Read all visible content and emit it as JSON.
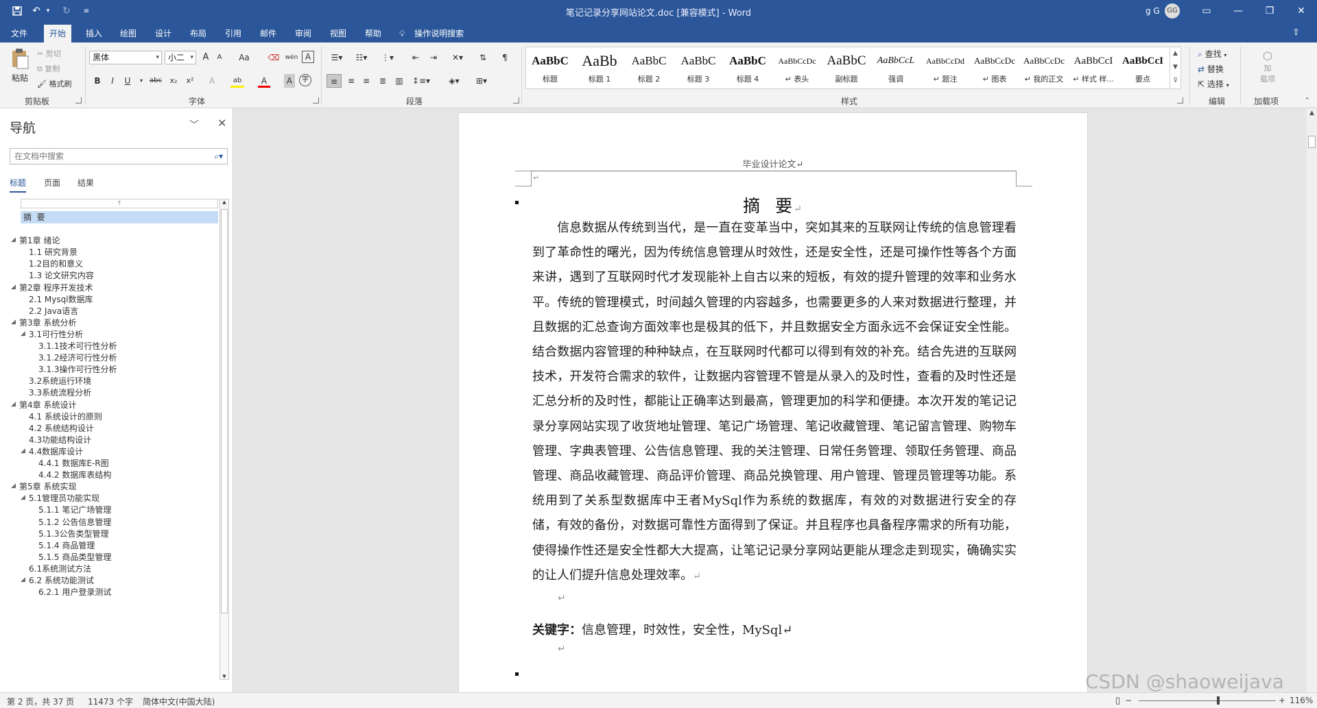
{
  "title_bar": {
    "document_title": "笔记记录分享网站论文.doc [兼容模式]  -  Word",
    "user_name": "g G",
    "user_initials": "GG",
    "quick_access": [
      "save-icon",
      "undo-icon",
      "redo-icon",
      "customize-icon"
    ],
    "window_buttons": [
      "ribbon-display-icon",
      "minimize-icon",
      "restore-icon",
      "close-icon"
    ]
  },
  "menu": {
    "tabs": [
      "文件",
      "开始",
      "插入",
      "绘图",
      "设计",
      "布局",
      "引用",
      "邮件",
      "审阅",
      "视图",
      "帮助"
    ],
    "active_tab": "开始",
    "tell_me": "操作说明搜索"
  },
  "ribbon": {
    "clipboard": {
      "label": "剪贴板",
      "paste": "粘贴",
      "cut": "剪切",
      "copy": "复制",
      "format_painter": "格式刷"
    },
    "font": {
      "label": "字体",
      "font_name": "黑体",
      "font_size": "小二",
      "case": "Aa",
      "grow": "A",
      "shrink": "A",
      "bold": "B",
      "italic": "I",
      "underline": "U",
      "strike": "abc",
      "subscript": "x₂",
      "superscript": "x²",
      "text_effects": "A",
      "highlight": "ab",
      "font_color": "A",
      "char_shading": "A",
      "enclose": "字",
      "pinyin": "wén",
      "char_border": "A"
    },
    "paragraph": {
      "label": "段落"
    },
    "styles": {
      "label": "样式",
      "items": [
        {
          "sample": "AaBbC",
          "name": "标题"
        },
        {
          "sample": "AaBb",
          "name": "标题 1"
        },
        {
          "sample": "AaBbC",
          "name": "标题 2"
        },
        {
          "sample": "AaBbC",
          "name": "标题 3"
        },
        {
          "sample": "AaBbC",
          "name": "标题 4"
        },
        {
          "sample": "AaBbCcDc",
          "name": "↵ 表头"
        },
        {
          "sample": "AaBbC",
          "name": "副标题"
        },
        {
          "sample": "AaBbCcL",
          "name": "强调"
        },
        {
          "sample": "AaBbCcDd",
          "name": "↵ 题注"
        },
        {
          "sample": "AaBbCcDc",
          "name": "↵ 图表"
        },
        {
          "sample": "AaBbCcDc",
          "name": "↵ 我的正文"
        },
        {
          "sample": "AaBbCcI",
          "name": "↵ 样式 样..."
        },
        {
          "sample": "AaBbCcI",
          "name": "要点"
        }
      ]
    },
    "editing": {
      "label": "编辑",
      "find": "查找",
      "replace": "替换",
      "select": "选择"
    },
    "addins": {
      "label": "加载项",
      "addins_button": "加\n载项"
    }
  },
  "nav_pane": {
    "title": "导航",
    "search_placeholder": "在文档中搜索",
    "tabs": [
      "标题",
      "页面",
      "结果"
    ],
    "active_tab": "标题",
    "items": [
      {
        "text": "摘  要",
        "level": 1,
        "selected": true
      },
      {
        "text": "第1章 绪论",
        "level": 1,
        "expanded": true
      },
      {
        "text": "1.1 研究背景",
        "level": 2
      },
      {
        "text": "1.2目的和意义",
        "level": 2
      },
      {
        "text": "1.3 论文研究内容",
        "level": 2
      },
      {
        "text": "第2章 程序开发技术",
        "level": 1,
        "expanded": true
      },
      {
        "text": "2.1 Mysql数据库",
        "level": 2
      },
      {
        "text": "2.2 Java语言",
        "level": 2
      },
      {
        "text": "第3章 系统分析",
        "level": 1,
        "expanded": true
      },
      {
        "text": "3.1可行性分析",
        "level": 2,
        "expanded": true
      },
      {
        "text": "3.1.1技术可行性分析",
        "level": 3
      },
      {
        "text": "3.1.2经济可行性分析",
        "level": 3
      },
      {
        "text": "3.1.3操作可行性分析",
        "level": 3
      },
      {
        "text": "3.2系统运行环境",
        "level": 2
      },
      {
        "text": "3.3系统流程分析",
        "level": 2
      },
      {
        "text": "第4章 系统设计",
        "level": 1,
        "expanded": true
      },
      {
        "text": "4.1 系统设计的原则",
        "level": 2
      },
      {
        "text": "4.2 系统结构设计",
        "level": 2
      },
      {
        "text": "4.3功能结构设计",
        "level": 2
      },
      {
        "text": "4.4数据库设计",
        "level": 2,
        "expanded": true
      },
      {
        "text": "4.4.1 数据库E-R图",
        "level": 3
      },
      {
        "text": "4.4.2 数据库表结构",
        "level": 3
      },
      {
        "text": "第5章 系统实现",
        "level": 1,
        "expanded": true
      },
      {
        "text": "5.1管理员功能实现",
        "level": 2,
        "expanded": true
      },
      {
        "text": "5.1.1 笔记广场管理",
        "level": 3
      },
      {
        "text": "5.1.2 公告信息管理",
        "level": 3
      },
      {
        "text": "5.1.3公告类型管理",
        "level": 3
      },
      {
        "text": "5.1.4 商品管理",
        "level": 3
      },
      {
        "text": "5.1.5 商品类型管理",
        "level": 3
      },
      {
        "text": "6.1系统测试方法",
        "level": 2
      },
      {
        "text": "6.2 系统功能测试",
        "level": 2,
        "expanded": true
      },
      {
        "text": "6.2.1 用户登录测试",
        "level": 3
      }
    ]
  },
  "document": {
    "header": "毕业设计论文↵",
    "header_mark": "↵",
    "abstract_title": "摘  要",
    "abstract_body": "信息数据从传统到当代，是一直在变革当中，突如其来的互联网让传统的信息管理看到了革命性的曙光，因为传统信息管理从时效性，还是安全性，还是可操作性等各个方面来讲，遇到了互联网时代才发现能补上自古以来的短板，有效的提升管理的效率和业务水平。传统的管理模式，时间越久管理的内容越多，也需要更多的人来对数据进行整理，并且数据的汇总查询方面效率也是极其的低下，并且数据安全方面永远不会保证安全性能。结合数据内容管理的种种缺点，在互联网时代都可以得到有效的补充。结合先进的互联网技术，开发符合需求的软件，让数据内容管理不管是从录入的及时性，查看的及时性还是汇总分析的及时性，都能让正确率达到最高，管理更加的科学和便捷。本次开发的笔记记录分享网站实现了收货地址管理、笔记广场管理、笔记收藏管理、笔记留言管理、购物车管理、字典表管理、公告信息管理、我的关注管理、日常任务管理、领取任务管理、商品管理、商品收藏管理、商品评价管理、商品兑换管理、用户管理、管理员管理等功能。系统用到了关系型数据库中王者MySql作为系统的数据库，有效的对数据进行安全的存储，有效的备份，对数据可靠性方面得到了保证。并且程序也具备程序需求的所有功能，使得操作性还是安全性都大大提高，让笔记记录分享网站更能从理念走到现实，确确实实的让人们提升信息处理效率。",
    "para_mark": "↵",
    "keywords_label": "关键字：",
    "keywords_text": "信息管理，时效性，安全性，MySql↵"
  },
  "status_bar": {
    "page": "第 2 页，共 37 页",
    "words": "11473 个字",
    "language": "简体中文(中国大陆)",
    "zoom_minus": "−",
    "zoom_plus": "+",
    "zoom": "116%",
    "zoom_fraction": 0.58
  },
  "watermark": "CSDN @shaoweijava"
}
